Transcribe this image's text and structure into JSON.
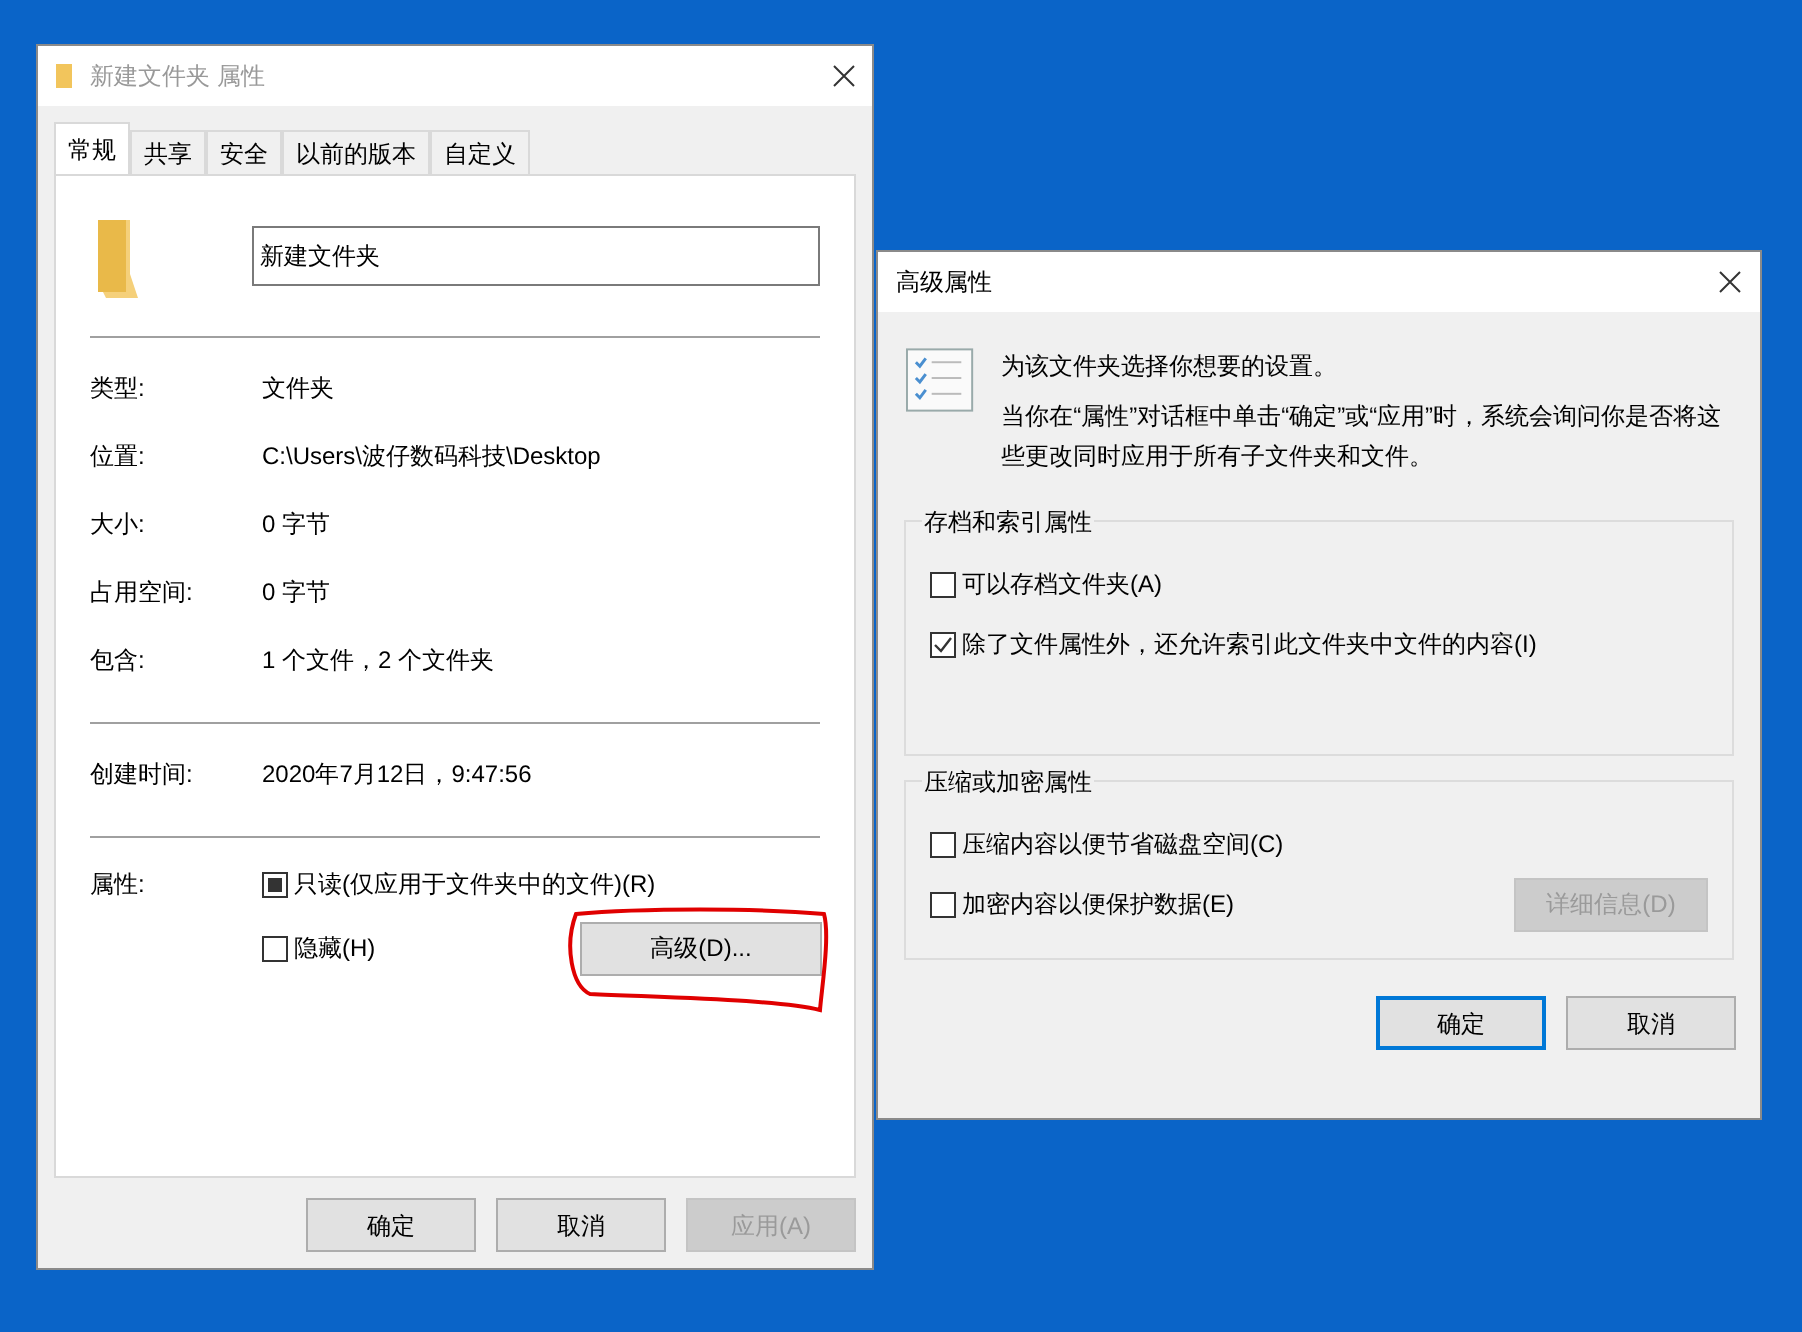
{
  "properties_window": {
    "title": "新建文件夹 属性",
    "tabs": [
      {
        "label": "常规",
        "selected": true
      },
      {
        "label": "共享",
        "selected": false
      },
      {
        "label": "安全",
        "selected": false
      },
      {
        "label": "以前的版本",
        "selected": false
      },
      {
        "label": "自定义",
        "selected": false
      }
    ],
    "name_field": {
      "value": "新建文件夹"
    },
    "info_groups": [
      [
        {
          "label": "类型:",
          "value": "文件夹"
        },
        {
          "label": "位置:",
          "value": "C:\\Users\\波仔数码科技\\Desktop"
        },
        {
          "label": "大小:",
          "value": "0 字节"
        },
        {
          "label": "占用空间:",
          "value": "0 字节"
        },
        {
          "label": "包含:",
          "value": "1 个文件，2 个文件夹"
        }
      ],
      [
        {
          "label": "创建时间:",
          "value": "2020年7月12日，9:47:56"
        }
      ]
    ],
    "attributes_label": "属性:",
    "attributes": [
      {
        "label": "只读(仅应用于文件夹中的文件)(R)",
        "checked": false,
        "indeterminate": true
      },
      {
        "label": "隐藏(H)",
        "checked": false,
        "indeterminate": false
      }
    ],
    "advanced_button": {
      "label": "高级(D)...",
      "highlighted": true
    },
    "buttons": [
      {
        "label": "确定",
        "disabled": false
      },
      {
        "label": "取消",
        "disabled": false
      },
      {
        "label": "应用(A)",
        "disabled": true
      }
    ]
  },
  "advanced_dialog": {
    "title": "高级属性",
    "intro": "为该文件夹选择你想要的设置。",
    "note": "当你在“属性”对话框中单击“确定”或“应用”时，系统会询问你是否将这些更改同时应用于所有子文件夹和文件。",
    "groups": [
      {
        "title": "存档和索引属性",
        "options": [
          {
            "label": "可以存档文件夹(A)",
            "checked": false
          },
          {
            "label": "除了文件属性外，还允许索引此文件夹中文件的内容(I)",
            "checked": true
          }
        ]
      },
      {
        "title": "压缩或加密属性",
        "options": [
          {
            "label": "压缩内容以便节省磁盘空间(C)",
            "checked": false
          },
          {
            "label": "加密内容以便保护数据(E)",
            "checked": false
          }
        ],
        "button": {
          "label": "详细信息(D)",
          "disabled": true
        }
      }
    ],
    "buttons": [
      {
        "label": "确定",
        "default": true
      },
      {
        "label": "取消",
        "default": false
      }
    ]
  }
}
